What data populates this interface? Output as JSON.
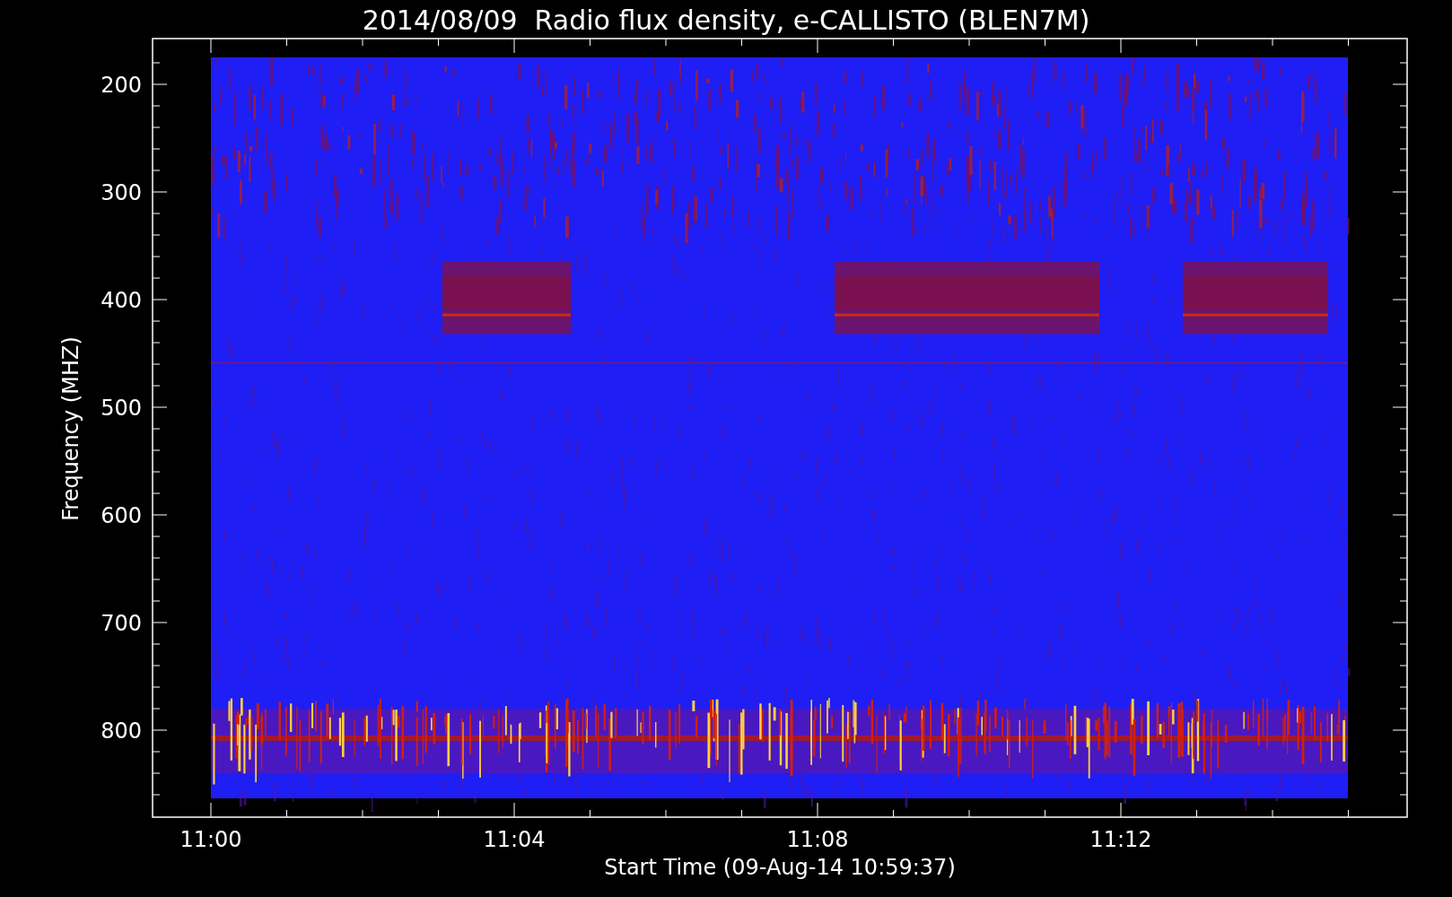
{
  "title": "2014/08/09  Radio flux density, e-CALLISTO (BLEN7M)",
  "y_axis": {
    "label": "Frequency (MHZ)",
    "ticks": [
      "200",
      "300",
      "400",
      "500",
      "600",
      "700",
      "800"
    ]
  },
  "x_axis": {
    "label": "Start Time (09-Aug-14 10:59:37)",
    "ticks": [
      "11:00",
      "11:04",
      "11:08",
      "11:12"
    ]
  }
}
